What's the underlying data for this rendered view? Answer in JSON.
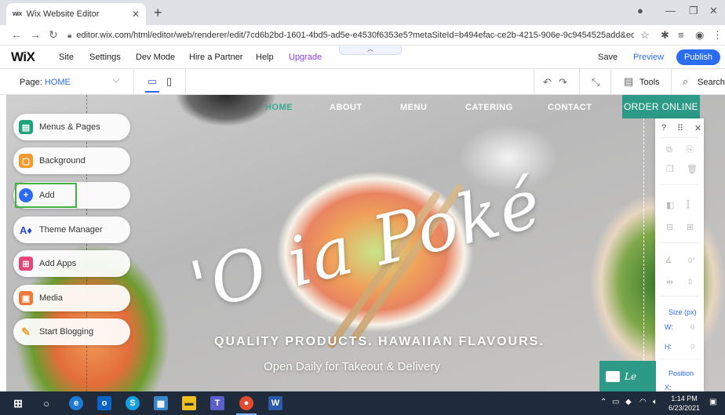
{
  "browser": {
    "tab_title": "Wix Website Editor",
    "tab_favicon": "WiX",
    "tab_close": "✕",
    "new_tab": "+",
    "url": "editor.wix.com/html/editor/web/renderer/edit/7cd6b2bd-1601-4bd5-ad5e-e4530f6353e5?metaSiteId=b494efac-ce2b-4215-906e-9c9454525add&editor..."
  },
  "wix_top": {
    "logo": "WiX",
    "menu": [
      "Site",
      "Settings",
      "Dev Mode",
      "Hire a Partner",
      "Help",
      "Upgrade"
    ],
    "save": "Save",
    "preview": "Preview",
    "publish": "Publish"
  },
  "wix_bar2": {
    "page_label": "Page:",
    "page_name": "HOME",
    "tools": "Tools",
    "search": "Search"
  },
  "site": {
    "nav": [
      "HOME",
      "ABOUT",
      "MENU",
      "CATERING",
      "CONTACT"
    ],
    "order_button": "ORDER ONLINE",
    "title": "'O ia Poké",
    "tagline": "QUALITY PRODUCTS. HAWAIIAN FLAVOURS.",
    "subtagline": "Open Daily for Takeout & Delivery",
    "chat_label": "Le"
  },
  "left_panel": [
    {
      "label": "Menus & Pages",
      "icon": "pages-icon",
      "color": "#1fa37a"
    },
    {
      "label": "Background",
      "icon": "background-icon",
      "color": "#f29a2e"
    },
    {
      "label": "Add",
      "icon": "plus-icon",
      "color": "#2b6cf0"
    },
    {
      "label": "Theme Manager",
      "icon": "theme-icon",
      "color": "#2b4bd6"
    },
    {
      "label": "Add Apps",
      "icon": "apps-icon",
      "color": "#e6457a"
    },
    {
      "label": "Media",
      "icon": "media-icon",
      "color": "#f07a3a"
    },
    {
      "label": "Start Blogging",
      "icon": "blog-icon",
      "color": "#f0a030"
    }
  ],
  "right_toolbar": {
    "help": "?",
    "size_label": "Size (px)",
    "w_label": "W:",
    "w_value": "0",
    "h_label": "H:",
    "h_value": "0",
    "rotation_value": "0°",
    "position_label": "Position",
    "x_label": "X:"
  },
  "taskbar": {
    "time": "1:14 PM",
    "date": "6/23/2021"
  }
}
